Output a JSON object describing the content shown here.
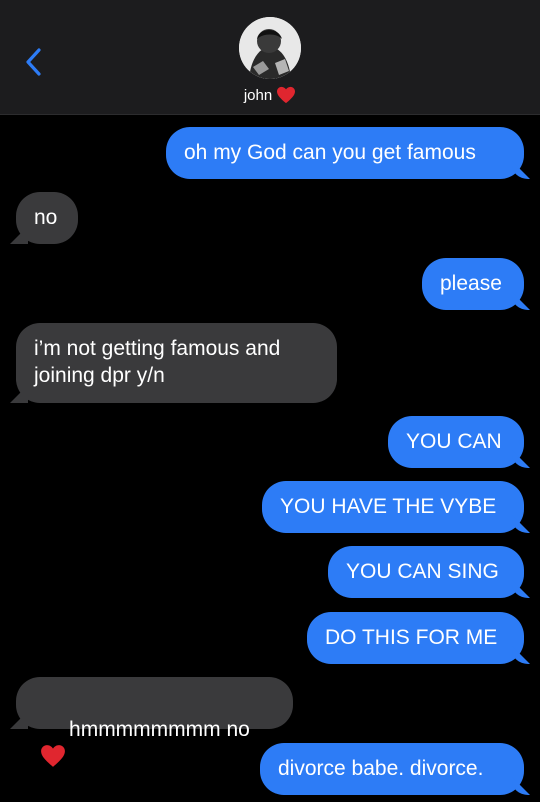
{
  "header": {
    "contact_name": "john",
    "back_icon": "chevron-left-icon",
    "name_emoji": "red-heart-icon"
  },
  "messages": [
    {
      "side": "sent",
      "text": "oh my God can you get famous"
    },
    {
      "side": "received",
      "text": "no"
    },
    {
      "side": "sent",
      "text": "please"
    },
    {
      "side": "received",
      "text": "i’m not getting famous and\njoining dpr y/n"
    },
    {
      "side": "sent",
      "text": "YOU CAN"
    },
    {
      "side": "sent",
      "text": "YOU HAVE THE VYBE"
    },
    {
      "side": "sent",
      "text": "YOU CAN SING"
    },
    {
      "side": "sent",
      "text": "DO THIS FOR ME"
    },
    {
      "side": "received",
      "text": "hmmmmmmmm no",
      "emoji": "red-heart-icon"
    },
    {
      "side": "sent",
      "text": "divorce babe. divorce."
    }
  ],
  "colors": {
    "sent_bubble": "#2d7cf6",
    "received_bubble": "#3a3a3c",
    "header_bg": "#1c1c1e",
    "accent": "#2d7cf6",
    "heart": "#e0262f"
  }
}
